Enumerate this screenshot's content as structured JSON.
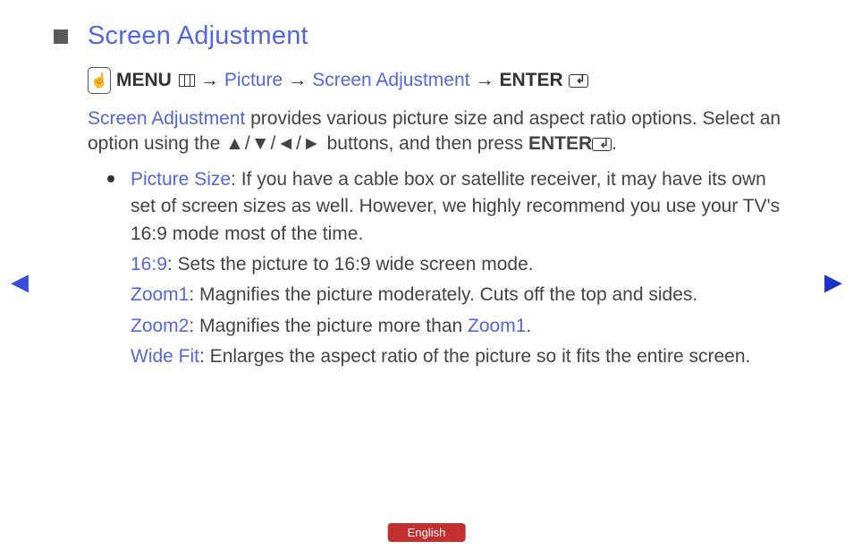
{
  "heading": "Screen Adjustment",
  "breadcrumb": {
    "menu_label": "MENU",
    "picture": "Picture",
    "screen_adjustment": "Screen Adjustment",
    "enter_label": "ENTER",
    "arrow": "→"
  },
  "intro": {
    "lead_term": "Screen Adjustment",
    "text_1": " provides various picture size and aspect ratio options. Select an option using the ",
    "direction_buttons": "▲/▼/◄/►",
    "text_2": " buttons, and then press ",
    "enter_label": "ENTER",
    "period": "."
  },
  "picture_size": {
    "label": "Picture Size",
    "text": ": If you have a cable box or satellite receiver, it may have its own set of screen sizes as well. However, we highly recommend you use your TV's 16:9 mode most of the time."
  },
  "ratio_169": {
    "label": "16:9",
    "text": ": Sets the picture to 16:9 wide screen mode."
  },
  "zoom1": {
    "label": "Zoom1",
    "text": ": Magnifies the picture moderately. Cuts off the top and sides."
  },
  "zoom2": {
    "label": "Zoom2",
    "text_before": ": Magnifies the picture more than ",
    "ref": "Zoom1",
    "text_after": "."
  },
  "widefit": {
    "label": "Wide Fit",
    "text": ": Enlarges the aspect ratio of the picture so it fits the entire screen."
  },
  "nav": {
    "left": "◀",
    "right": "▶"
  },
  "language": "English"
}
